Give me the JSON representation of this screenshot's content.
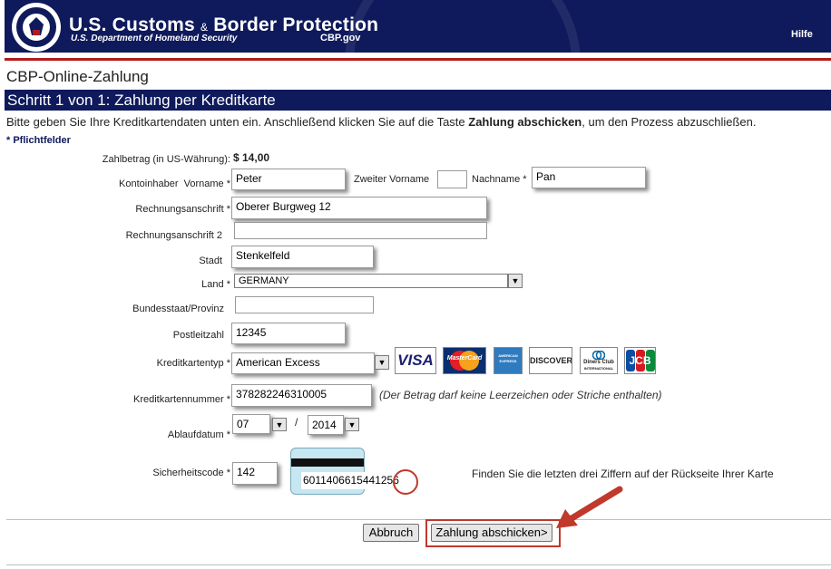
{
  "header": {
    "agency_title": "U.S. Customs",
    "agency_amp": "&",
    "agency_title_2": "Border Protection",
    "department": "U.S. Department of Homeland Security",
    "site": "CBP.gov",
    "help": "Hilfe"
  },
  "page": {
    "title": "CBP-Online-Zahlung",
    "step_title": "Schritt 1 von 1: Zahlung per Kreditkarte",
    "instruction_pre": "Bitte geben Sie Ihre Kreditkartendaten unten ein. Anschließend klicken Sie auf die Taste ",
    "instruction_bold": "Zahlung abschicken",
    "instruction_post": ", um den Prozess abzuschließen.",
    "required_note": "* Pflichtfelder"
  },
  "form": {
    "amount_label": "Zahlbetrag (in US-Währung):",
    "amount_value": "$ 14,00",
    "account_holder_label": "Kontoinhaber",
    "first_name_label": "Vorname",
    "first_name_value": "Peter",
    "middle_name_label": "Zweiter Vorname",
    "middle_name_value": "",
    "last_name_label": "Nachname",
    "last_name_value": "Pan",
    "address_label": "Rechnungsanschrift",
    "address_value": "Oberer Burgweg 12",
    "address2_label": "Rechnungsanschrift 2",
    "address2_value": "",
    "city_label": "Stadt",
    "city_value": "Stenkelfeld",
    "country_label": "Land",
    "country_value": "GERMANY",
    "state_label": "Bundesstaat/Provinz",
    "state_value": "",
    "zip_label": "Postleitzahl",
    "zip_value": "12345",
    "card_type_label": "Kreditkartentyp",
    "card_type_value": "American Excess",
    "card_number_label": "Kreditkartennummer",
    "card_number_value": "378282246310005",
    "card_number_hint": "(Der Betrag darf keine Leerzeichen oder Striche enthalten)",
    "expiry_label": "Ablaufdatum",
    "expiry_month": "07",
    "expiry_sep": "/",
    "expiry_year": "2014",
    "security_label": "Sicherheitscode",
    "security_value": "142",
    "card_back_number": "6011406615441",
    "card_back_cvv": "256",
    "security_hint": "Finden Sie die letzten drei Ziffern auf der Rückseite Ihrer Karte",
    "required_star": "*"
  },
  "cards": [
    {
      "name": "VISA",
      "icon": "visa-logo"
    },
    {
      "name": "MasterCard",
      "icon": "mastercard-logo"
    },
    {
      "name": "AMERICAN EXPRESS",
      "icon": "amex-logo"
    },
    {
      "name": "DISCOVER",
      "icon": "discover-logo"
    },
    {
      "name": "Diners Club",
      "name2": "INTERNATIONAL",
      "icon": "diners-logo"
    },
    {
      "name": "JCB",
      "icon": "jcb-logo"
    }
  ],
  "buttons": {
    "cancel": "Abbruch",
    "submit": "Zahlung abschicken>"
  },
  "colors": {
    "header_bg": "#0f1a5c",
    "accent_red": "#b31b1b",
    "annotation_red": "#c0392b"
  }
}
